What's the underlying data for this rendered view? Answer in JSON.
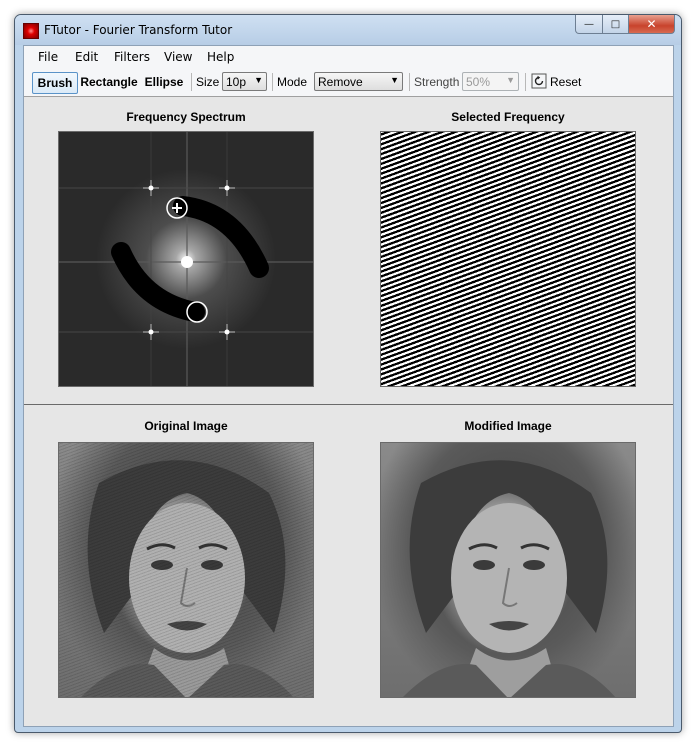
{
  "window": {
    "title": "FTutor - Fourier Transform Tutor"
  },
  "menu": {
    "file": "File",
    "edit": "Edit",
    "filters": "Filters",
    "view": "View",
    "help": "Help"
  },
  "toolbar": {
    "brush": "Brush",
    "rectangle": "Rectangle",
    "ellipse": "Ellipse",
    "size_label": "Size",
    "size_value": "10p",
    "mode_label": "Mode",
    "mode_value": "Remove",
    "strength_label": "Strength",
    "strength_value": "50%",
    "reset": "Reset"
  },
  "panels": {
    "spectrum": "Frequency Spectrum",
    "selected": "Selected Frequency",
    "original": "Original Image",
    "modified": "Modified Image"
  }
}
